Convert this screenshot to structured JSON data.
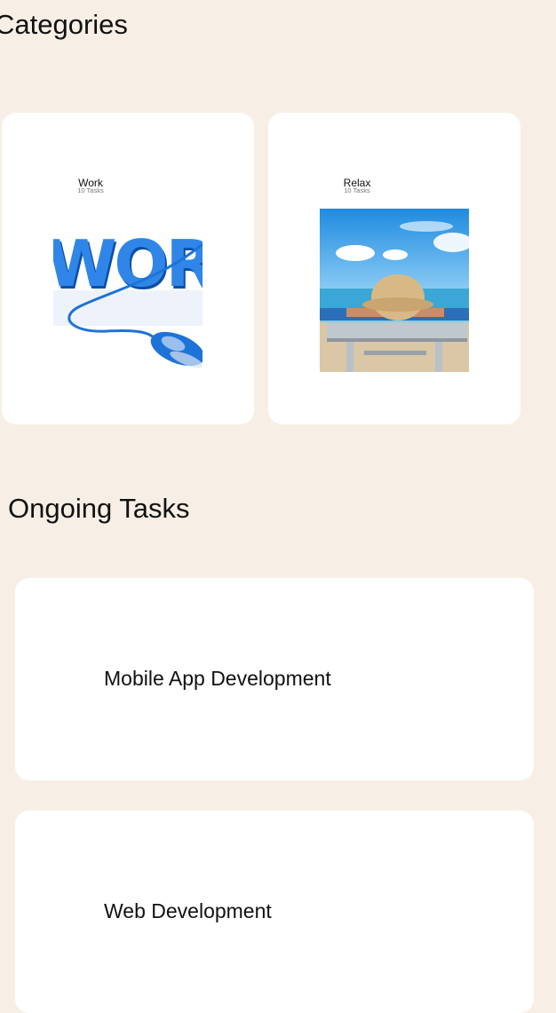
{
  "categories_section": {
    "title": "Categories",
    "items": [
      {
        "label": "Work",
        "count": "10 Tasks"
      },
      {
        "label": "Relax",
        "count": "10 Tasks"
      }
    ]
  },
  "ongoing_section": {
    "title": "Ongoing Tasks",
    "tasks": [
      {
        "name": "Mobile App Development"
      },
      {
        "name": "Web Development"
      }
    ]
  },
  "colors": {
    "background": "#f7efe6",
    "card": "#ffffff",
    "work_blue": "#1e73d8"
  }
}
